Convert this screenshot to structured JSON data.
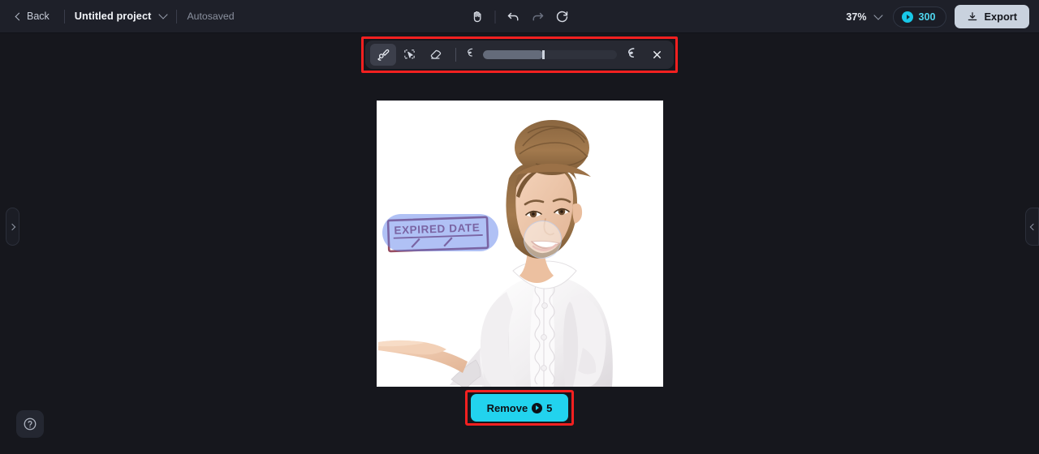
{
  "topbar": {
    "back_label": "Back",
    "project_title": "Untitled project",
    "autosaved_label": "Autosaved",
    "zoom_level": "37%",
    "credits_count": "300",
    "export_label": "Export",
    "tools": [
      {
        "name": "hand-tool",
        "label": "Hand"
      },
      {
        "name": "undo",
        "label": "Undo"
      },
      {
        "name": "redo",
        "label": "Redo"
      },
      {
        "name": "reset",
        "label": "Reset"
      }
    ]
  },
  "toolbar": {
    "tools": [
      {
        "name": "brush-tool",
        "label": "Brush",
        "active": true
      },
      {
        "name": "magic-select-tool",
        "label": "Magic select",
        "active": false
      },
      {
        "name": "eraser-tool",
        "label": "Eraser",
        "active": false
      }
    ],
    "brush_size_min_label": "Small brush",
    "brush_size_max_label": "Large brush",
    "brush_size_percent": 45,
    "close_label": "Close"
  },
  "canvas": {
    "image_alt": "Smiling young woman in white ruffled blouse presenting with open palm",
    "stamp_text": "EXPIRED DATE",
    "mask_color": "#5a7deb",
    "background_color": "#ffffff"
  },
  "action": {
    "remove_label": "Remove",
    "remove_cost": "5"
  },
  "panels": {
    "left_handle_label": "Expand left panel",
    "right_handle_label": "Expand right panel"
  },
  "help": {
    "label": "Help"
  },
  "colors": {
    "app_background": "#16171d",
    "topbar_background": "#1e2029",
    "accent_cyan": "#22d3ee",
    "annotation_red": "#f42020",
    "export_button": "#c9d2de"
  }
}
